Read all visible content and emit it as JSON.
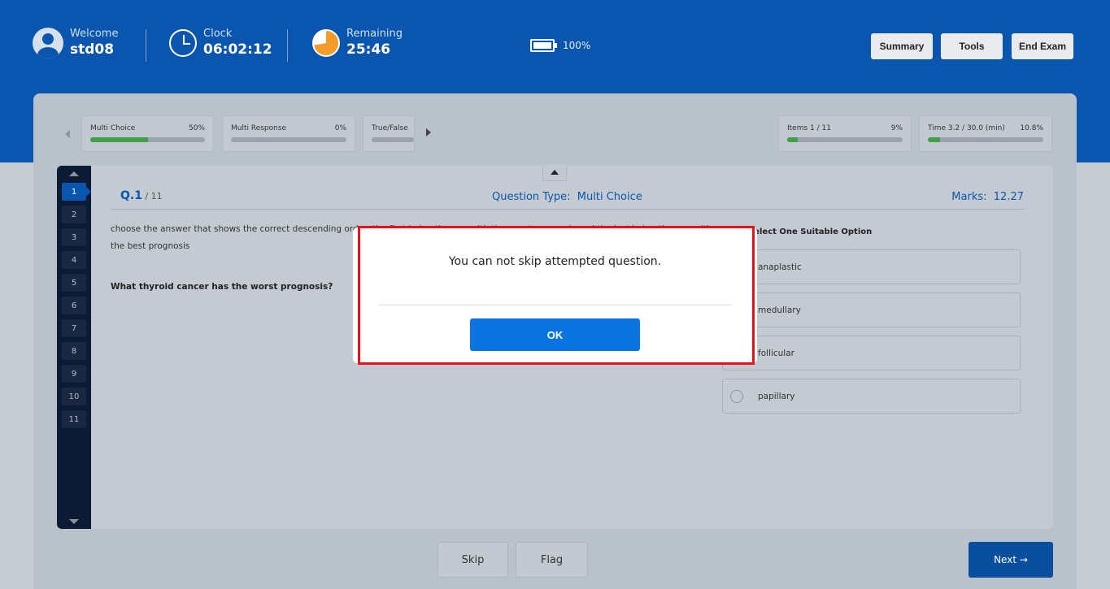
{
  "header": {
    "welcome_label": "Welcome",
    "username": "std08",
    "clock_label": "Clock",
    "clock_value": "06:02:12",
    "remaining_label": "Remaining",
    "remaining_value": "25:46",
    "battery_percent": "100%",
    "buttons": {
      "summary": "Summary",
      "tools": "Tools",
      "end_exam": "End Exam"
    }
  },
  "sections": [
    {
      "label": "Multi Choice",
      "percent": "50%",
      "progress": 0.5
    },
    {
      "label": "Multi Response",
      "percent": "0%",
      "progress": 0
    },
    {
      "label": "True/False",
      "percent": "",
      "progress": 0
    }
  ],
  "stats": {
    "items": {
      "label": "Items  1 / 11",
      "percent": "9%",
      "progress": 0.09
    },
    "time": {
      "label": "Time  3.2 / 30.0 (min)",
      "percent": "10.8%",
      "progress": 0.108
    }
  },
  "question_nav": [
    "1",
    "2",
    "3",
    "4",
    "5",
    "6",
    "7",
    "8",
    "9",
    "10",
    "11"
  ],
  "question": {
    "number": "Q.1",
    "total": " / 11",
    "type_label": "Question Type:",
    "type_value": "Multi Choice",
    "marks_label": "Marks:",
    "marks_value": "12.27",
    "instruction": "choose the answer that shows the correct descending order, the first being the one with the worst prognosis and the last being the one with the best prognosis",
    "text": "What thyroid cancer has the worst prognosis?",
    "options_heading": "Select One Suitable Option",
    "options": [
      "anaplastic",
      "medullary",
      "follicular",
      "papillary"
    ]
  },
  "footer": {
    "skip": "Skip",
    "flag": "Flag",
    "next": "Next →"
  },
  "modal": {
    "message": "You can not skip attempted question.",
    "ok": "OK"
  },
  "colors": {
    "brand": "#0a56ae",
    "progress": "#3fa046",
    "highlight": "#e5121b",
    "ok_button": "#0a74e0"
  }
}
